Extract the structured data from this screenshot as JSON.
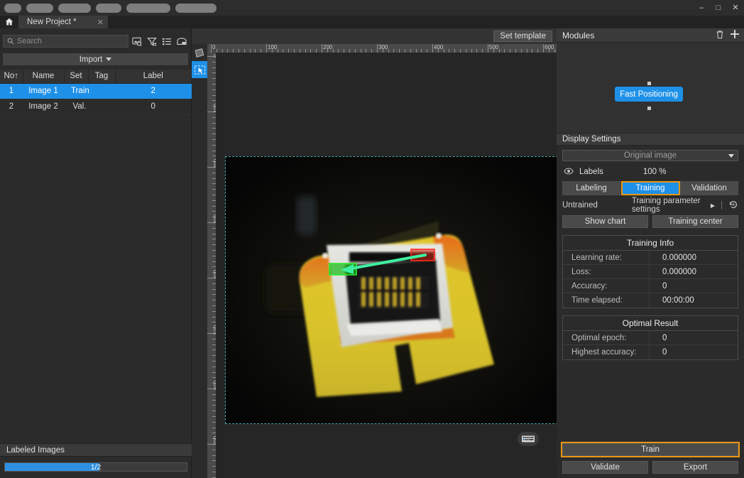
{
  "window": {
    "minimize_label": "–",
    "maximize_label": "□",
    "close_label": "✕",
    "blurred_menu_widths": [
      24,
      38,
      46,
      36,
      62,
      58
    ]
  },
  "tabs": {
    "home_icon": "home-icon",
    "project_tab_label": "New Project *",
    "close_label": "✕"
  },
  "left_panel": {
    "search": {
      "placeholder": "Search",
      "value": "",
      "icon": "search-icon"
    },
    "toolbar_icons": [
      "image-search-icon",
      "filter-icon",
      "list-icon",
      "folder-image-icon"
    ],
    "import_label": "Import",
    "columns": [
      "No↑",
      "Name",
      "Set",
      "Tag",
      "Label"
    ],
    "rows": [
      {
        "no": "1",
        "name": "Image 1",
        "set": "Train",
        "tag": "",
        "label": "2",
        "selected": true
      },
      {
        "no": "2",
        "name": "Image 2",
        "set": "Val.",
        "tag": "",
        "label": "0",
        "selected": false
      }
    ],
    "labeled_images_title": "Labeled Images",
    "progress_text": "1/2",
    "progress_percent": 52
  },
  "canvas": {
    "set_template_label": "Set template",
    "tools": [
      {
        "name": "shape-tool",
        "selected": false
      },
      {
        "name": "select-arrow-tool",
        "selected": true
      }
    ],
    "ruler_h_labels": [
      "0",
      "100",
      "200",
      "300",
      "400",
      "500",
      "600"
    ],
    "ruler_v_labels": [
      "0",
      "100",
      "200",
      "300",
      "400",
      "500",
      "600"
    ],
    "keyboard_icon": "keyboard-shortcuts-icon",
    "annotation": {
      "arrow_color": "#3ef0a0",
      "start_box_color": "#ff2a2a",
      "end_box_color": "#17d017"
    }
  },
  "right_panel": {
    "modules": {
      "title": "Modules",
      "delete_icon": "trash-icon",
      "add_icon": "plus-icon",
      "node_label": "Fast Positioning"
    },
    "display_settings": {
      "title": "Display Settings",
      "image_mode": "Original image",
      "labels_label": "Labels",
      "labels_icon": "eye-icon",
      "labels_opacity": "100 %"
    },
    "mode_tabs": [
      {
        "label": "Labeling",
        "active": false
      },
      {
        "label": "Training",
        "active": true
      },
      {
        "label": "Validation",
        "active": false
      }
    ],
    "status": {
      "state": "Untrained",
      "params_label": "Training parameter settings",
      "params_arrow": "▶",
      "history_icon": "history-restore-icon"
    },
    "mid_buttons": [
      {
        "label": "Show chart",
        "name": "show-chart-button"
      },
      {
        "label": "Training center",
        "name": "training-center-button"
      }
    ],
    "training_info": {
      "title": "Training Info",
      "rows": [
        {
          "key": "Learning rate:",
          "value": "0.000000"
        },
        {
          "key": "Loss:",
          "value": "0.000000"
        },
        {
          "key": "Accuracy:",
          "value": "0"
        },
        {
          "key": "Time elapsed:",
          "value": "00:00:00"
        }
      ]
    },
    "optimal_result": {
      "title": "Optimal Result",
      "rows": [
        {
          "key": "Optimal epoch:",
          "value": "0"
        },
        {
          "key": "Highest accuracy:",
          "value": "0"
        }
      ]
    },
    "actions": {
      "train_label": "Train",
      "validate_label": "Validate",
      "export_label": "Export"
    }
  },
  "colors": {
    "accent_blue": "#1e90e8",
    "focus_orange": "#e89611",
    "panel_bg": "#2b2b2b"
  }
}
